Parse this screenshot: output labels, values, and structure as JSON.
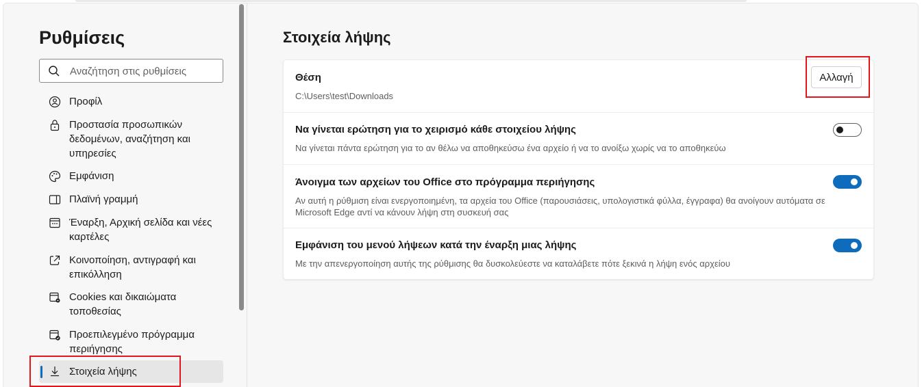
{
  "sidebar": {
    "title": "Ρυθμίσεις",
    "search_placeholder": "Αναζήτηση στις ρυθμίσεις",
    "items": [
      {
        "label": "Προφίλ",
        "icon": "profile-icon"
      },
      {
        "label": "Προστασία προσωπικών δεδομένων, αναζήτηση και υπηρεσίες",
        "icon": "lock-icon"
      },
      {
        "label": "Εμφάνιση",
        "icon": "palette-icon"
      },
      {
        "label": "Πλαϊνή γραμμή",
        "icon": "sidebar-icon"
      },
      {
        "label": "Έναρξη, Αρχική σελίδα και νέες καρτέλες",
        "icon": "start-page-icon"
      },
      {
        "label": "Κοινοποίηση, αντιγραφή και επικόλληση",
        "icon": "share-icon"
      },
      {
        "label": "Cookies και δικαιώματα τοποθεσίας",
        "icon": "cookies-icon"
      },
      {
        "label": "Προεπιλεγμένο πρόγραμμα περιήγησης",
        "icon": "default-browser-icon"
      },
      {
        "label": "Στοιχεία λήψης",
        "icon": "download-icon",
        "active": true
      }
    ]
  },
  "main": {
    "title": "Στοιχεία λήψης",
    "location": {
      "title": "Θέση",
      "path": "C:\\Users\\test\\Downloads",
      "button_label": "Αλλαγή"
    },
    "settings": [
      {
        "title": "Να γίνεται ερώτηση για το χειρισμό κάθε στοιχείου λήψης",
        "description": "Να γίνεται πάντα ερώτηση για το αν θέλω να αποθηκεύσω ένα αρχείο ή να το ανοίξω χωρίς να το αποθηκεύω",
        "enabled": false
      },
      {
        "title": "Άνοιγμα των αρχείων του Office στο πρόγραμμα περιήγησης",
        "description": "Αν αυτή η ρύθμιση είναι ενεργοποιημένη, τα αρχεία του Office (παρουσιάσεις, υπολογιστικά φύλλα, έγγραφα) θα ανοίγουν αυτόματα σε Microsoft Edge αντί να κάνουν λήψη στη συσκευή σας",
        "enabled": true
      },
      {
        "title": "Εμφάνιση του μενού λήψεων κατά την έναρξη μιας λήψης",
        "description": "Με την απενεργοποίηση αυτής της ρύθμισης θα δυσκολεύεστε να καταλάβετε πότε ξεκινά η λήψη ενός αρχείου",
        "enabled": true
      }
    ]
  },
  "colors": {
    "accent": "#0f6cbd",
    "highlight_box": "#e4141b"
  }
}
